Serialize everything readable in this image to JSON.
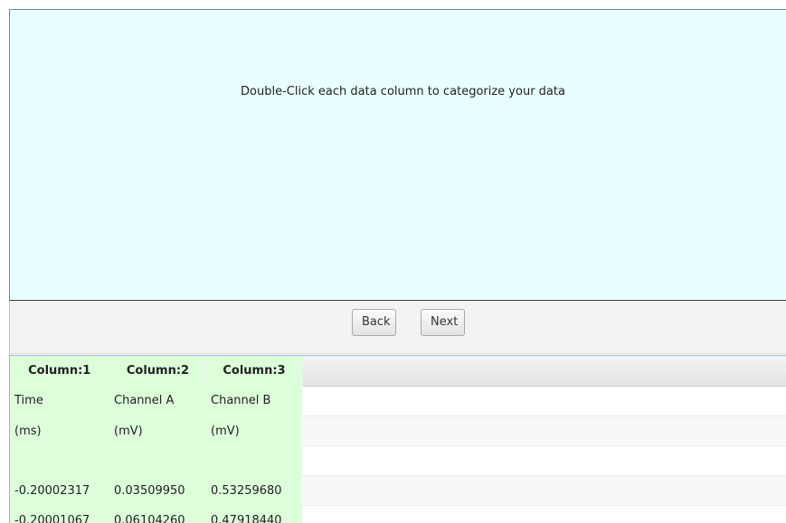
{
  "instruction": {
    "text": "Double-Click each data column to categorize your data"
  },
  "buttons": {
    "back_label": "Back",
    "next_label": "Next"
  },
  "table": {
    "headers": [
      "Column:1",
      "Column:2",
      "Column:3"
    ],
    "rows": [
      [
        "Time",
        "Channel A",
        "Channel B"
      ],
      [
        "(ms)",
        "(mV)",
        "(mV)"
      ],
      [
        "",
        "",
        ""
      ],
      [
        "-0.20002317",
        "0.03509950",
        "0.53259680"
      ],
      [
        "-0.20001067",
        "0.06104260",
        "0.47918440"
      ]
    ]
  },
  "colors": {
    "instruction_bg": "#e9feff",
    "column_bg": "#dcffda",
    "button_bar_bg": "#f3f3f3"
  }
}
